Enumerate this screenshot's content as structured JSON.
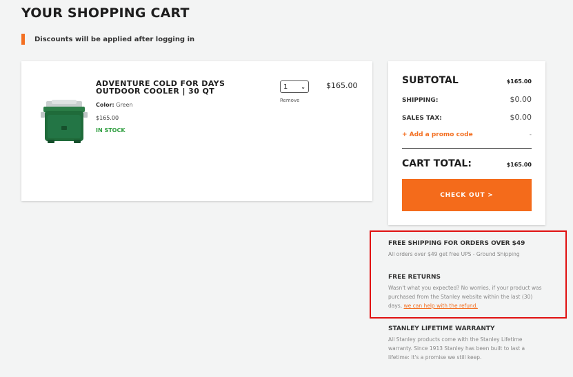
{
  "page": {
    "title": "YOUR SHOPPING CART"
  },
  "notice": {
    "text": "Discounts will be applied after logging in"
  },
  "cart": {
    "item": {
      "name": "ADVENTURE COLD FOR DAYS OUTDOOR COOLER | 30 QT",
      "color_label": "Color:",
      "color_value": "Green",
      "price": "$165.00",
      "stock": "IN STOCK",
      "quantity": "1",
      "remove_label": "Remove",
      "line_total": "$165.00"
    }
  },
  "summary": {
    "subtotal_label": "SUBTOTAL",
    "subtotal_value": "$165.00",
    "shipping_label": "SHIPPING:",
    "shipping_value": "$0.00",
    "tax_label": "SALES TAX:",
    "tax_value": "$0.00",
    "promo_label": "+ Add a promo code",
    "promo_value": "-",
    "total_label": "CART TOTAL:",
    "total_value": "$165.00",
    "checkout_label": "CHECK OUT >"
  },
  "info": {
    "shipping_title": "FREE SHIPPING FOR ORDERS OVER $49",
    "shipping_text": "All orders over $49 get free UPS - Ground Shipping",
    "returns_title": "FREE RETURNS",
    "returns_text": "Wasn't what you expected? No worries, if your product was purchased from the Stanley website within the last (30) days,",
    "returns_link": "we can help with the refund.",
    "warranty_title": "STANLEY LIFETIME WARRANTY",
    "warranty_text": "All Stanley products come with the Stanley Lifetime warranty. Since 1913 Stanley has been built to last a lifetime: It's a promise we still keep."
  },
  "colors": {
    "accent": "#f36f21",
    "checkout": "#f46b1b",
    "in_stock": "#2e9e3f",
    "highlight": "#e01010",
    "cooler_green": "#1f6b3a"
  },
  "icons": {
    "product_image": "cooler-image",
    "qty_dropdown": "chevron-down-icon"
  }
}
